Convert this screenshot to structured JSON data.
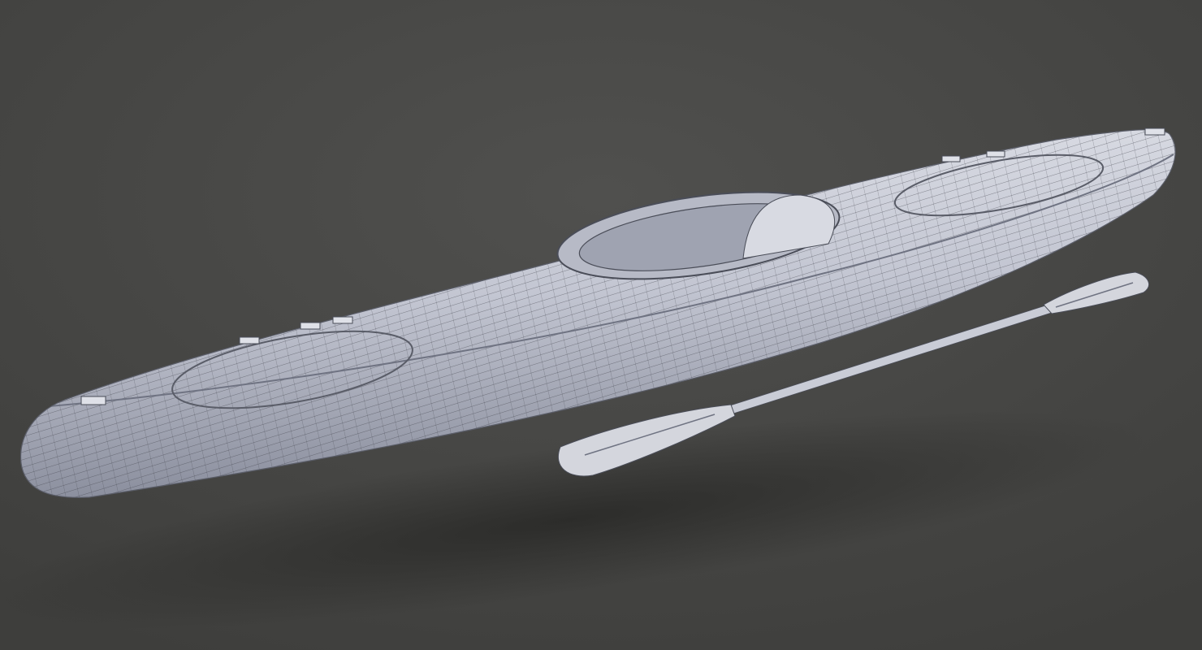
{
  "scene": {
    "subject": "kayak",
    "accessory": "paddle",
    "render_style": "wireframe"
  },
  "colors": {
    "background": "#4a4a48",
    "shadow": "#2e2e2c",
    "hull": "#c9ccd6",
    "hull_shade": "#8d91a0",
    "wire": "#3a3c44",
    "paddle": "#d4d6dd"
  }
}
